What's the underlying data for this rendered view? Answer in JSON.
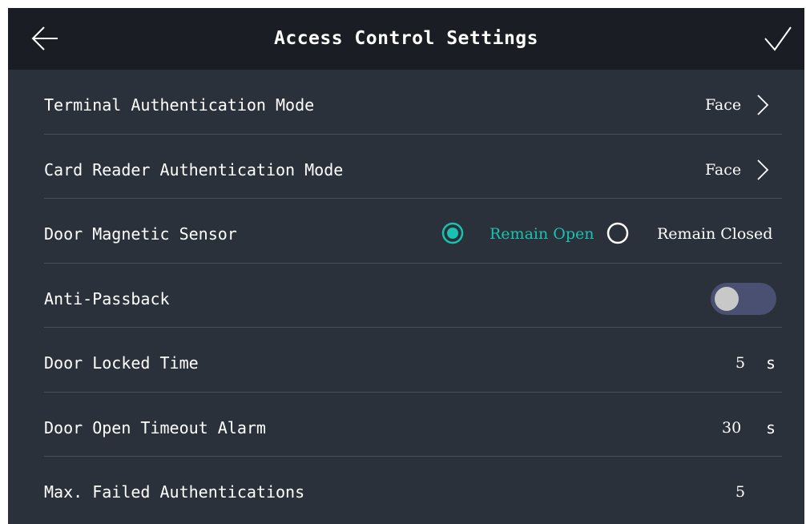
{
  "header": {
    "title": "Access Control Settings",
    "back_icon": "arrow-left-icon",
    "confirm_icon": "checkmark-icon",
    "background": "#1a1e24"
  },
  "colors": {
    "background": "#2b313a",
    "accent": "#19c2b0",
    "divider": "#474e59",
    "toggle_track": "#4a5072"
  },
  "rows": {
    "terminal_auth": {
      "label": "Terminal Authentication Mode",
      "value": "Face"
    },
    "card_reader_auth": {
      "label": "Card Reader Authentication Mode",
      "value": "Face"
    },
    "door_magnetic": {
      "label": "Door Magnetic Sensor",
      "options": [
        "Remain Open",
        "Remain Closed"
      ],
      "selected": "Remain Open"
    },
    "anti_passback": {
      "label": "Anti-Passback",
      "enabled": false
    },
    "door_locked_time": {
      "label": "Door Locked Time",
      "value": "5",
      "unit": "s"
    },
    "door_open_timeout": {
      "label": "Door Open Timeout Alarm",
      "value": "30",
      "unit": "s"
    },
    "max_failed": {
      "label": "Max. Failed Authentications",
      "value": "5"
    }
  }
}
